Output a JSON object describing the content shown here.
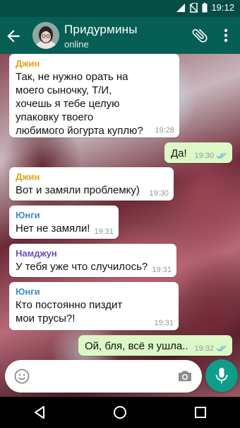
{
  "status_bar": {
    "time": "19:12"
  },
  "header": {
    "title": "Придурмины",
    "status": "online"
  },
  "messages": [
    {
      "direction": "in",
      "sender": "Джин",
      "sender_color": "#e2a316",
      "text": "Так, не нужно орать на\nмоего сыночку, Т/И,\nхочешь я тебе целую\nупаковку твоего\nлюбимого йогурта куплю?",
      "time": "19:28"
    },
    {
      "direction": "out",
      "text": "Да!",
      "time": "19:30",
      "read": true
    },
    {
      "direction": "in",
      "sender": "Джин",
      "sender_color": "#e2a316",
      "text": "Вот и замяли проблемку)",
      "time": "19:30"
    },
    {
      "direction": "in",
      "sender": "Юнги",
      "sender_color": "#3f8ac9",
      "text": "Нет не замяли!",
      "time": "19:31"
    },
    {
      "direction": "in",
      "sender": "Намджун",
      "sender_color": "#6b4fbb",
      "text": "У тебя уже что случилось?",
      "time": "19:31"
    },
    {
      "direction": "in",
      "sender": "Юнги",
      "sender_color": "#3f8ac9",
      "text": "Кто постоянно пиздит\nмои трусы?!",
      "time": "19:31"
    },
    {
      "direction": "out",
      "text": "Ой, бля, всё я ушла..",
      "time": "19:32",
      "read": true
    }
  ],
  "composer": {
    "placeholder": "",
    "value": ""
  },
  "colors": {
    "header": "#075e54",
    "status_bar": "#054d44",
    "outgoing_bubble": "#dcf8c6",
    "read_ticks": "#4fb6ec",
    "fab": "#0f9d8a"
  }
}
